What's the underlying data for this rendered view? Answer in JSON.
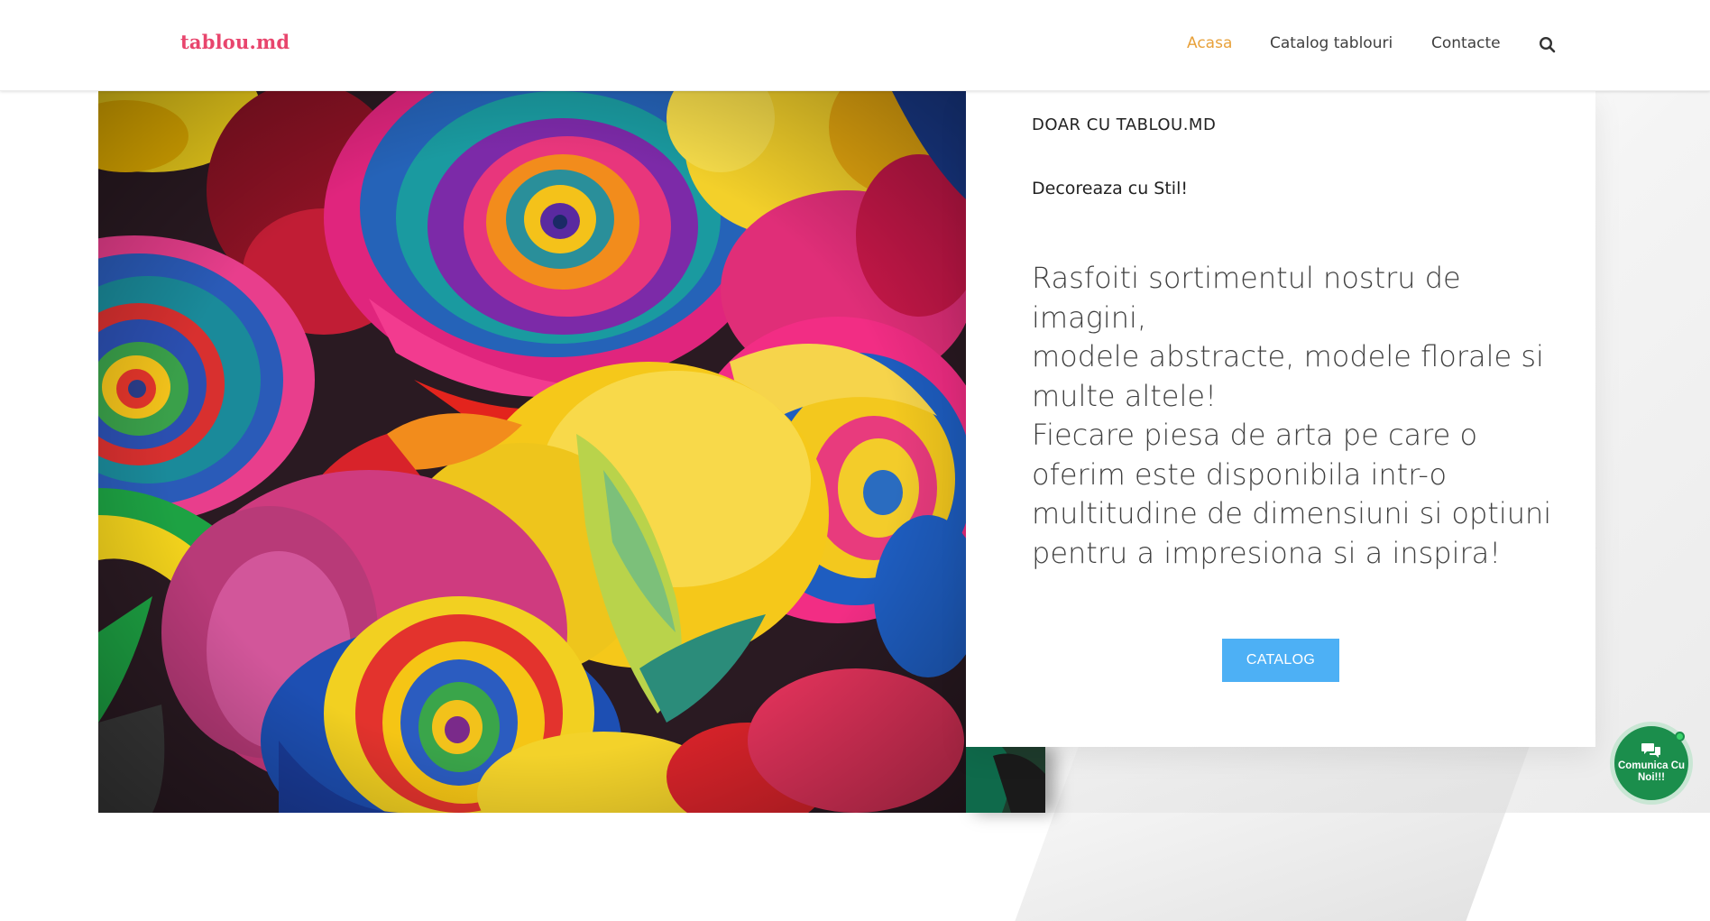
{
  "header": {
    "logo": "tablou.md",
    "nav": [
      {
        "label": "Acasa",
        "active": true
      },
      {
        "label": "Catalog tablouri",
        "active": false
      },
      {
        "label": "Contacte",
        "active": false
      }
    ],
    "search_icon": "search-icon"
  },
  "hero": {
    "eyebrow": "DOAR CU TABLOU.MD",
    "tagline": "Decoreaza cu Stil!",
    "body_lines": [
      "Rasfoiti sortimentul nostru de",
      "imagini,",
      "modele abstracte, modele florale si",
      "multe altele!",
      "Fiecare piesa de arta pe care o",
      "oferim este disponibila intr-o",
      "multitudine de dimensiuni si optiuni",
      "pentru a impresiona si a inspira!"
    ],
    "button": "CATALOG",
    "image_subject": "rainbow roses"
  },
  "chat": {
    "line1": "Comunica Cu",
    "line2": "Noi!!!",
    "icon": "chat-bubbles-icon"
  },
  "colors": {
    "logo": "#e8456d",
    "nav_active": "#e8a13a",
    "button": "#4db0f5",
    "chat": "#1b8e4c"
  }
}
